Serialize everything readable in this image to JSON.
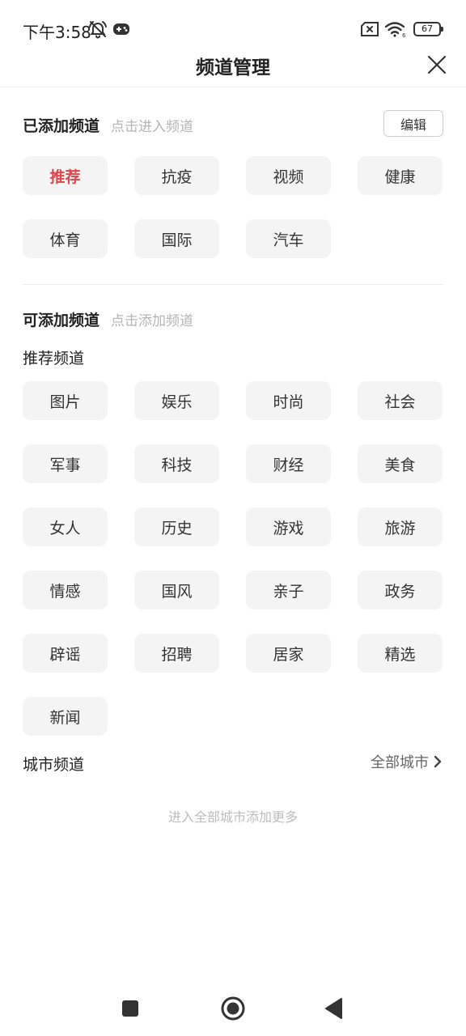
{
  "status_bar": {
    "time": "下午3:58",
    "battery": "67",
    "icons": [
      "bell-mute-icon",
      "game-icon",
      "sim-off-icon",
      "wifi-icon",
      "battery-icon"
    ]
  },
  "header": {
    "title": "频道管理",
    "close_icon": "close-icon"
  },
  "added": {
    "title": "已添加频道",
    "hint": "点击进入频道",
    "edit_label": "编辑",
    "channels": [
      "推荐",
      "抗疫",
      "视频",
      "健康",
      "体育",
      "国际",
      "汽车"
    ],
    "active_index": 0,
    "accent_color": "#e0454b"
  },
  "available": {
    "title": "可添加频道",
    "hint": "点击添加频道",
    "recommended_title": "推荐频道",
    "recommended": [
      "图片",
      "娱乐",
      "时尚",
      "社会",
      "军事",
      "科技",
      "财经",
      "美食",
      "女人",
      "历史",
      "游戏",
      "旅游",
      "情感",
      "国风",
      "亲子",
      "政务",
      "辟谣",
      "招聘",
      "居家",
      "精选",
      "新闻"
    ],
    "city_title": "城市频道",
    "all_cities_label": "全部城市",
    "city_hint": "进入全部城市添加更多"
  },
  "nav": {
    "icons": [
      "recent-apps-icon",
      "home-icon",
      "back-icon"
    ]
  }
}
